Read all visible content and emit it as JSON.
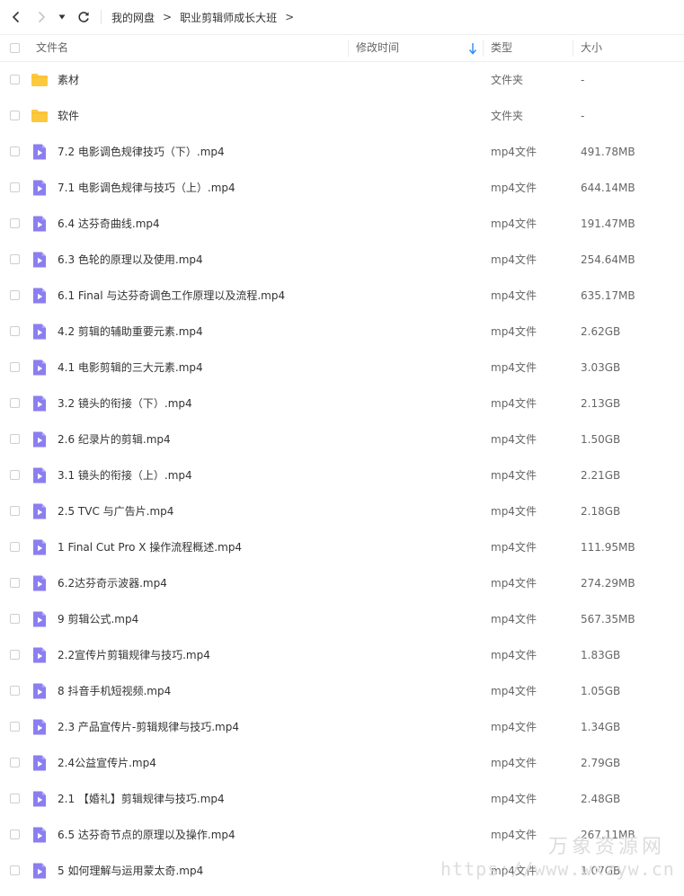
{
  "breadcrumb": {
    "items": [
      "我的网盘",
      "职业剪辑师成长大班"
    ],
    "separator": ">"
  },
  "columns": {
    "name": "文件名",
    "modified": "修改时间",
    "type": "类型",
    "size": "大小"
  },
  "colors": {
    "folder": "#fcc93e",
    "video": "#8b7ef0",
    "sort_arrow": "#2a8af6"
  },
  "files": [
    {
      "name": "素材",
      "type": "文件夹",
      "size": "-",
      "kind": "folder"
    },
    {
      "name": "软件",
      "type": "文件夹",
      "size": "-",
      "kind": "folder"
    },
    {
      "name": "7.2 电影调色规律技巧（下）.mp4",
      "type": "mp4文件",
      "size": "491.78MB",
      "kind": "video"
    },
    {
      "name": "7.1 电影调色规律与技巧（上）.mp4",
      "type": "mp4文件",
      "size": "644.14MB",
      "kind": "video"
    },
    {
      "name": "6.4 达芬奇曲线.mp4",
      "type": "mp4文件",
      "size": "191.47MB",
      "kind": "video"
    },
    {
      "name": "6.3 色轮的原理以及使用.mp4",
      "type": "mp4文件",
      "size": "254.64MB",
      "kind": "video"
    },
    {
      "name": "6.1 Final 与达芬奇调色工作原理以及流程.mp4",
      "type": "mp4文件",
      "size": "635.17MB",
      "kind": "video"
    },
    {
      "name": "4.2 剪辑的辅助重要元素.mp4",
      "type": "mp4文件",
      "size": "2.62GB",
      "kind": "video"
    },
    {
      "name": "4.1 电影剪辑的三大元素.mp4",
      "type": "mp4文件",
      "size": "3.03GB",
      "kind": "video"
    },
    {
      "name": "3.2 镜头的衔接（下）.mp4",
      "type": "mp4文件",
      "size": "2.13GB",
      "kind": "video"
    },
    {
      "name": "2.6 纪录片的剪辑.mp4",
      "type": "mp4文件",
      "size": "1.50GB",
      "kind": "video"
    },
    {
      "name": "3.1 镜头的衔接（上）.mp4",
      "type": "mp4文件",
      "size": "2.21GB",
      "kind": "video"
    },
    {
      "name": "2.5 TVC 与广告片.mp4",
      "type": "mp4文件",
      "size": "2.18GB",
      "kind": "video"
    },
    {
      "name": "1 Final Cut Pro X 操作流程概述.mp4",
      "type": "mp4文件",
      "size": "111.95MB",
      "kind": "video"
    },
    {
      "name": "6.2达芬奇示波器.mp4",
      "type": "mp4文件",
      "size": "274.29MB",
      "kind": "video"
    },
    {
      "name": "9 剪辑公式.mp4",
      "type": "mp4文件",
      "size": "567.35MB",
      "kind": "video"
    },
    {
      "name": "2.2宣传片剪辑规律与技巧.mp4",
      "type": "mp4文件",
      "size": "1.83GB",
      "kind": "video"
    },
    {
      "name": "8 抖音手机短视频.mp4",
      "type": "mp4文件",
      "size": "1.05GB",
      "kind": "video"
    },
    {
      "name": "2.3 产品宣传片-剪辑规律与技巧.mp4",
      "type": "mp4文件",
      "size": "1.34GB",
      "kind": "video"
    },
    {
      "name": "2.4公益宣传片.mp4",
      "type": "mp4文件",
      "size": "2.79GB",
      "kind": "video"
    },
    {
      "name": "2.1 【婚礼】剪辑规律与技巧.mp4",
      "type": "mp4文件",
      "size": "2.48GB",
      "kind": "video"
    },
    {
      "name": "6.5 达芬奇节点的原理以及操作.mp4",
      "type": "mp4文件",
      "size": "267.11MB",
      "kind": "video"
    },
    {
      "name": "5 如何理解与运用蒙太奇.mp4",
      "type": "mp4文件",
      "size": "1.07GB",
      "kind": "video"
    }
  ],
  "watermark": {
    "line1": "万象资源网",
    "line2": "https://www.wxzyw.cn"
  }
}
